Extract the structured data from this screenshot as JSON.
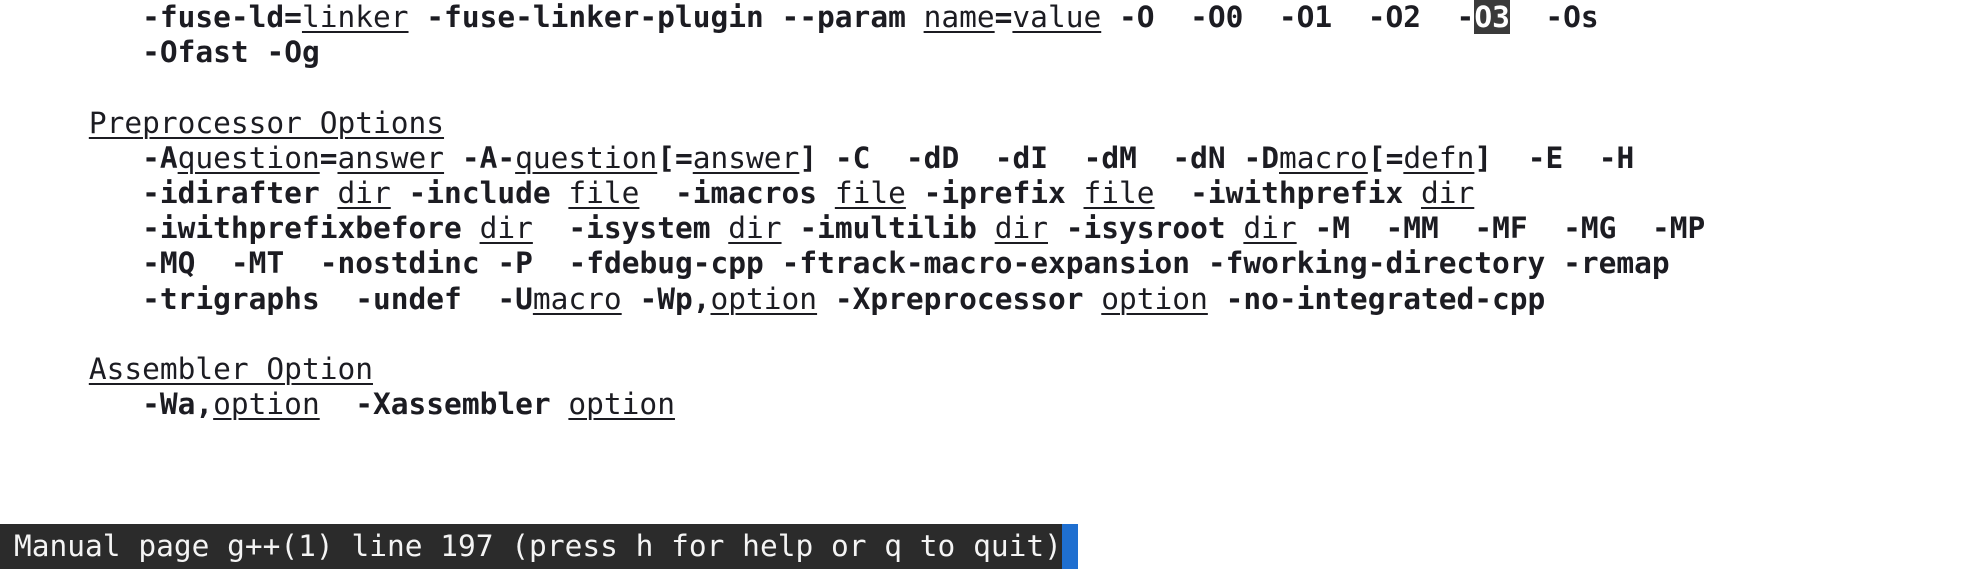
{
  "terminal": {
    "background_color": "#ffffff",
    "foreground_color": "#1c1c22",
    "highlight_background": "#3a3a3a",
    "highlight_foreground": "#ffffff",
    "cursor_color": "#1f6fd0",
    "status_background": "#2b2b2b",
    "status_foreground": "#f4f4f4"
  },
  "man_page": {
    "program": "g++(1)",
    "lines": [
      {
        "id": "line-optimize-continued",
        "segments": [
          {
            "text": "        ",
            "style": "plain"
          },
          {
            "text": "-fuse-ld=",
            "style": "bold"
          },
          {
            "text": "linker",
            "style": "underline"
          },
          {
            "text": " ",
            "style": "plain"
          },
          {
            "text": "-fuse-linker-plugin",
            "style": "bold"
          },
          {
            "text": " ",
            "style": "plain"
          },
          {
            "text": "--param",
            "style": "bold"
          },
          {
            "text": " ",
            "style": "plain"
          },
          {
            "text": "name",
            "style": "underline"
          },
          {
            "text": "=",
            "style": "bold"
          },
          {
            "text": "value",
            "style": "underline"
          },
          {
            "text": " ",
            "style": "plain"
          },
          {
            "text": "-O",
            "style": "bold"
          },
          {
            "text": "  ",
            "style": "plain"
          },
          {
            "text": "-O0",
            "style": "bold"
          },
          {
            "text": "  ",
            "style": "plain"
          },
          {
            "text": "-O1",
            "style": "bold"
          },
          {
            "text": "  ",
            "style": "plain"
          },
          {
            "text": "-O2",
            "style": "bold"
          },
          {
            "text": "  ",
            "style": "plain"
          },
          {
            "text": "-",
            "style": "bold"
          },
          {
            "text": "O3",
            "style": "highlight"
          },
          {
            "text": "  ",
            "style": "plain"
          },
          {
            "text": "-Os",
            "style": "bold"
          }
        ]
      },
      {
        "id": "line-ofast-og",
        "segments": [
          {
            "text": "        ",
            "style": "plain"
          },
          {
            "text": "-Ofast",
            "style": "bold"
          },
          {
            "text": " ",
            "style": "plain"
          },
          {
            "text": "-Og",
            "style": "bold"
          }
        ]
      },
      {
        "id": "line-blank-1",
        "segments": [
          {
            "text": " ",
            "style": "plain"
          }
        ]
      },
      {
        "id": "heading-preprocessor-options",
        "segments": [
          {
            "text": "     ",
            "style": "plain"
          },
          {
            "text": "Preprocessor Options",
            "style": "underline"
          }
        ]
      },
      {
        "id": "line-A-options",
        "segments": [
          {
            "text": "        ",
            "style": "plain"
          },
          {
            "text": "-A",
            "style": "bold"
          },
          {
            "text": "question",
            "style": "underline"
          },
          {
            "text": "=",
            "style": "bold"
          },
          {
            "text": "answer",
            "style": "underline"
          },
          {
            "text": " ",
            "style": "plain"
          },
          {
            "text": "-A-",
            "style": "bold"
          },
          {
            "text": "question",
            "style": "underline"
          },
          {
            "text": "[",
            "style": "bold"
          },
          {
            "text": "=",
            "style": "bold"
          },
          {
            "text": "answer",
            "style": "underline"
          },
          {
            "text": "]",
            "style": "bold"
          },
          {
            "text": " ",
            "style": "plain"
          },
          {
            "text": "-C",
            "style": "bold"
          },
          {
            "text": "  ",
            "style": "plain"
          },
          {
            "text": "-dD",
            "style": "bold"
          },
          {
            "text": "  ",
            "style": "plain"
          },
          {
            "text": "-dI",
            "style": "bold"
          },
          {
            "text": "  ",
            "style": "plain"
          },
          {
            "text": "-dM",
            "style": "bold"
          },
          {
            "text": "  ",
            "style": "plain"
          },
          {
            "text": "-dN",
            "style": "bold"
          },
          {
            "text": " ",
            "style": "plain"
          },
          {
            "text": "-D",
            "style": "bold"
          },
          {
            "text": "macro",
            "style": "underline"
          },
          {
            "text": "[",
            "style": "bold"
          },
          {
            "text": "=",
            "style": "bold"
          },
          {
            "text": "defn",
            "style": "underline"
          },
          {
            "text": "]",
            "style": "bold"
          },
          {
            "text": "  ",
            "style": "plain"
          },
          {
            "text": "-E",
            "style": "bold"
          },
          {
            "text": "  ",
            "style": "plain"
          },
          {
            "text": "-H",
            "style": "bold"
          }
        ]
      },
      {
        "id": "line-idirafter",
        "segments": [
          {
            "text": "        ",
            "style": "plain"
          },
          {
            "text": "-idirafter",
            "style": "bold"
          },
          {
            "text": " ",
            "style": "plain"
          },
          {
            "text": "dir",
            "style": "underline"
          },
          {
            "text": " ",
            "style": "plain"
          },
          {
            "text": "-include",
            "style": "bold"
          },
          {
            "text": " ",
            "style": "plain"
          },
          {
            "text": "file",
            "style": "underline"
          },
          {
            "text": "  ",
            "style": "plain"
          },
          {
            "text": "-imacros",
            "style": "bold"
          },
          {
            "text": " ",
            "style": "plain"
          },
          {
            "text": "file",
            "style": "underline"
          },
          {
            "text": " ",
            "style": "plain"
          },
          {
            "text": "-iprefix",
            "style": "bold"
          },
          {
            "text": " ",
            "style": "plain"
          },
          {
            "text": "file",
            "style": "underline"
          },
          {
            "text": "  ",
            "style": "plain"
          },
          {
            "text": "-iwithprefix",
            "style": "bold"
          },
          {
            "text": " ",
            "style": "plain"
          },
          {
            "text": "dir",
            "style": "underline"
          }
        ]
      },
      {
        "id": "line-iwithprefixbefore",
        "segments": [
          {
            "text": "        ",
            "style": "plain"
          },
          {
            "text": "-iwithprefixbefore",
            "style": "bold"
          },
          {
            "text": " ",
            "style": "plain"
          },
          {
            "text": "dir",
            "style": "underline"
          },
          {
            "text": "  ",
            "style": "plain"
          },
          {
            "text": "-isystem",
            "style": "bold"
          },
          {
            "text": " ",
            "style": "plain"
          },
          {
            "text": "dir",
            "style": "underline"
          },
          {
            "text": " ",
            "style": "plain"
          },
          {
            "text": "-imultilib",
            "style": "bold"
          },
          {
            "text": " ",
            "style": "plain"
          },
          {
            "text": "dir",
            "style": "underline"
          },
          {
            "text": " ",
            "style": "plain"
          },
          {
            "text": "-isysroot",
            "style": "bold"
          },
          {
            "text": " ",
            "style": "plain"
          },
          {
            "text": "dir",
            "style": "underline"
          },
          {
            "text": " ",
            "style": "plain"
          },
          {
            "text": "-M",
            "style": "bold"
          },
          {
            "text": "  ",
            "style": "plain"
          },
          {
            "text": "-MM",
            "style": "bold"
          },
          {
            "text": "  ",
            "style": "plain"
          },
          {
            "text": "-MF",
            "style": "bold"
          },
          {
            "text": "  ",
            "style": "plain"
          },
          {
            "text": "-MG",
            "style": "bold"
          },
          {
            "text": "  ",
            "style": "plain"
          },
          {
            "text": "-MP",
            "style": "bold"
          }
        ]
      },
      {
        "id": "line-MQ",
        "segments": [
          {
            "text": "        ",
            "style": "plain"
          },
          {
            "text": "-MQ",
            "style": "bold"
          },
          {
            "text": "  ",
            "style": "plain"
          },
          {
            "text": "-MT",
            "style": "bold"
          },
          {
            "text": "  ",
            "style": "plain"
          },
          {
            "text": "-nostdinc",
            "style": "bold"
          },
          {
            "text": " ",
            "style": "plain"
          },
          {
            "text": "-P",
            "style": "bold"
          },
          {
            "text": "  ",
            "style": "plain"
          },
          {
            "text": "-fdebug-cpp",
            "style": "bold"
          },
          {
            "text": " ",
            "style": "plain"
          },
          {
            "text": "-ftrack-macro-expansion",
            "style": "bold"
          },
          {
            "text": " ",
            "style": "plain"
          },
          {
            "text": "-fworking-directory",
            "style": "bold"
          },
          {
            "text": " ",
            "style": "plain"
          },
          {
            "text": "-remap",
            "style": "bold"
          }
        ]
      },
      {
        "id": "line-trigraphs",
        "segments": [
          {
            "text": "        ",
            "style": "plain"
          },
          {
            "text": "-trigraphs",
            "style": "bold"
          },
          {
            "text": "  ",
            "style": "plain"
          },
          {
            "text": "-undef",
            "style": "bold"
          },
          {
            "text": "  ",
            "style": "plain"
          },
          {
            "text": "-U",
            "style": "bold"
          },
          {
            "text": "macro",
            "style": "underline"
          },
          {
            "text": " ",
            "style": "plain"
          },
          {
            "text": "-Wp,",
            "style": "bold"
          },
          {
            "text": "option",
            "style": "underline"
          },
          {
            "text": " ",
            "style": "plain"
          },
          {
            "text": "-Xpreprocessor",
            "style": "bold"
          },
          {
            "text": " ",
            "style": "plain"
          },
          {
            "text": "option",
            "style": "underline"
          },
          {
            "text": " ",
            "style": "plain"
          },
          {
            "text": "-no-integrated-cpp",
            "style": "bold"
          }
        ]
      },
      {
        "id": "line-blank-2",
        "segments": [
          {
            "text": " ",
            "style": "plain"
          }
        ]
      },
      {
        "id": "heading-assembler-option",
        "segments": [
          {
            "text": "     ",
            "style": "plain"
          },
          {
            "text": "Assembler Option",
            "style": "underline"
          }
        ]
      },
      {
        "id": "line-Wa",
        "segments": [
          {
            "text": "        ",
            "style": "plain"
          },
          {
            "text": "-Wa,",
            "style": "bold"
          },
          {
            "text": "option",
            "style": "underline"
          },
          {
            "text": "  ",
            "style": "plain"
          },
          {
            "text": "-Xassembler",
            "style": "bold"
          },
          {
            "text": " ",
            "style": "plain"
          },
          {
            "text": "option",
            "style": "underline"
          }
        ]
      }
    ]
  },
  "status_bar": {
    "text": "Manual page g++(1) line 197 (press h for help or q to quit)",
    "manual_label": "Manual page",
    "page_name": "g++(1)",
    "line_label": "line",
    "line_number": "197",
    "hint": "(press h for help or q to quit)",
    "cursor_visible": true
  }
}
